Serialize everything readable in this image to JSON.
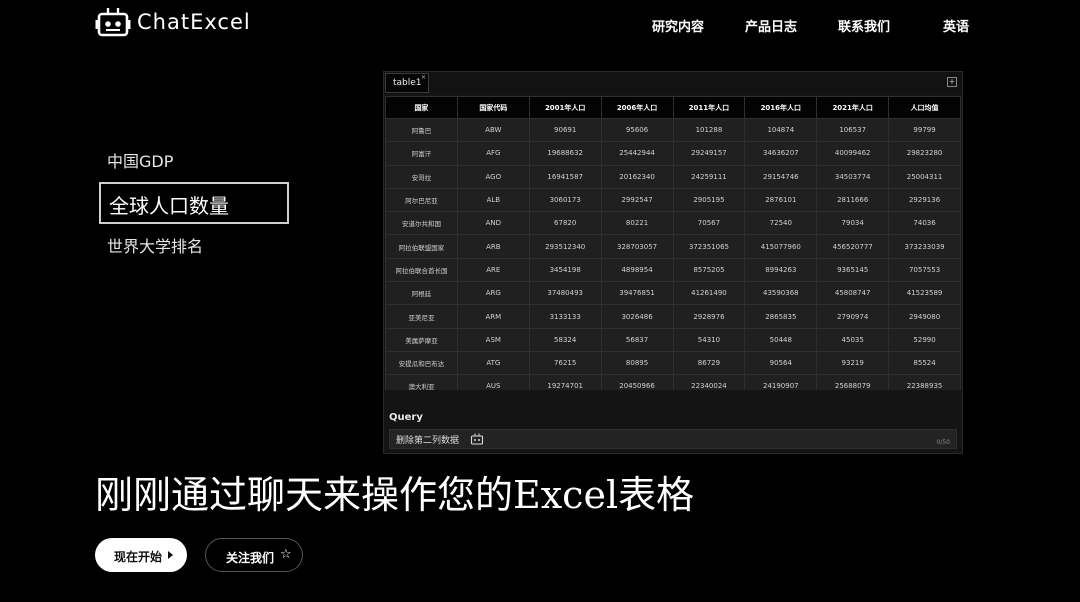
{
  "brand": {
    "name": "ChatExcel",
    "logo_icon": "robot-icon"
  },
  "nav": [
    "研究内容",
    "产品日志",
    "联系我们",
    "英语"
  ],
  "datasets": {
    "items": [
      "中国GDP",
      "全球人口数量",
      "世界大学排名"
    ],
    "active_index": 1
  },
  "table_panel": {
    "tab_name": "table1",
    "tab_close": "×",
    "add_tab": "+",
    "columns": [
      "国家",
      "国家代码",
      "2001年人口",
      "2006年人口",
      "2011年人口",
      "2016年人口",
      "2021年人口",
      "人口均值"
    ],
    "rows": [
      [
        "阿鲁巴",
        "ABW",
        "90691",
        "95606",
        "101288",
        "104874",
        "106537",
        "99799"
      ],
      [
        "阿富汗",
        "AFG",
        "19688632",
        "25442944",
        "29249157",
        "34636207",
        "40099462",
        "29823280"
      ],
      [
        "安哥拉",
        "AGO",
        "16941587",
        "20162340",
        "24259111",
        "29154746",
        "34503774",
        "25004311"
      ],
      [
        "阿尔巴尼亚",
        "ALB",
        "3060173",
        "2992547",
        "2905195",
        "2876101",
        "2811666",
        "2929136"
      ],
      [
        "安道尔共和国",
        "AND",
        "67820",
        "80221",
        "70567",
        "72540",
        "79034",
        "74036"
      ],
      [
        "阿拉伯联盟国家",
        "ARB",
        "293512340",
        "328703057",
        "372351065",
        "415077960",
        "456520777",
        "373233039"
      ],
      [
        "阿拉伯联合酋长国",
        "ARE",
        "3454198",
        "4898954",
        "8575205",
        "8994263",
        "9365145",
        "7057553"
      ],
      [
        "阿根廷",
        "ARG",
        "37480493",
        "39476851",
        "41261490",
        "43590368",
        "45808747",
        "41523589"
      ],
      [
        "亚美尼亚",
        "ARM",
        "3133133",
        "3026486",
        "2928976",
        "2865835",
        "2790974",
        "2949080"
      ],
      [
        "美属萨摩亚",
        "ASM",
        "58324",
        "56837",
        "54310",
        "50448",
        "45035",
        "52990"
      ],
      [
        "安提瓜和巴布达",
        "ATG",
        "76215",
        "80895",
        "86729",
        "90564",
        "93219",
        "85524"
      ],
      [
        "澳大利亚",
        "AUS",
        "19274701",
        "20450966",
        "22340024",
        "24190907",
        "25688079",
        "22388935"
      ]
    ],
    "query": {
      "label": "Query",
      "text": "删除第二列数据",
      "counter": "0/50",
      "bot_icon": "robot-icon"
    }
  },
  "hero": {
    "title": "刚刚通过聊天来操作您的Excel表格"
  },
  "buttons": {
    "start": "现在开始",
    "start_icon": "caret-right-icon",
    "follow": "关注我们",
    "follow_icon": "star-icon",
    "follow_glyph": "☆"
  }
}
